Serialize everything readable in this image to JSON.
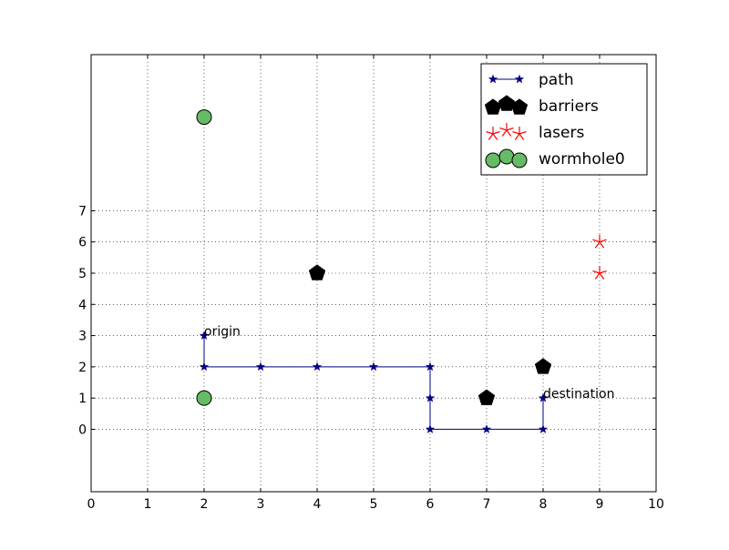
{
  "chart_data": {
    "type": "scatter",
    "title": "",
    "xlabel": "",
    "ylabel": "",
    "xlim": [
      0,
      10
    ],
    "ylim": [
      -2,
      12
    ],
    "x_ticks": [
      "0",
      "1",
      "2",
      "3",
      "4",
      "5",
      "6",
      "7",
      "8",
      "9",
      "10"
    ],
    "y_ticks": [
      "0",
      "1",
      "2",
      "3",
      "4",
      "5",
      "6",
      "7"
    ],
    "grid": true,
    "legend_position": "top-right",
    "series": [
      {
        "name": "path",
        "kind": "line",
        "marker": "star",
        "color": "#000080",
        "points": [
          [
            2,
            3
          ],
          [
            2,
            2
          ],
          [
            3,
            2
          ],
          [
            4,
            2
          ],
          [
            5,
            2
          ],
          [
            6,
            2
          ],
          [
            6,
            1
          ],
          [
            6,
            0
          ],
          [
            7,
            0
          ],
          [
            8,
            0
          ],
          [
            8,
            1
          ]
        ]
      },
      {
        "name": "barriers",
        "kind": "scatter",
        "marker": "pentagon",
        "color": "#000000",
        "points": [
          [
            4,
            5
          ],
          [
            7,
            1
          ],
          [
            8,
            2
          ]
        ]
      },
      {
        "name": "lasers",
        "kind": "scatter",
        "marker": "asterisk",
        "color": "#ff0000",
        "points": [
          [
            9,
            6
          ],
          [
            9,
            5
          ]
        ]
      },
      {
        "name": "wormhole0",
        "kind": "scatter",
        "marker": "circle",
        "color": "#66bb66",
        "points": [
          [
            2,
            10
          ],
          [
            2,
            1
          ]
        ]
      }
    ],
    "annotations": [
      {
        "text": "origin",
        "x": 2,
        "y": 3
      },
      {
        "text": "destination",
        "x": 8,
        "y": 1
      }
    ]
  }
}
